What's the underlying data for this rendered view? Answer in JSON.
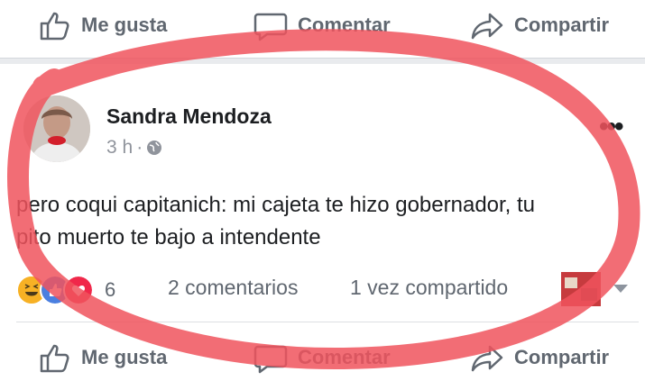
{
  "top_actions": {
    "like": "Me gusta",
    "comment": "Comentar",
    "share": "Compartir"
  },
  "post": {
    "author": "Sandra Mendoza",
    "time": "3 h",
    "separator": "·",
    "privacy_icon": "globe-icon",
    "text_line1": "pero coqui capitanich: mi cajeta te hizo gobernador, tu",
    "text_line2": "pito muerto te bajo a intendente",
    "reactions": [
      "haha-icon",
      "like-icon",
      "love-icon"
    ],
    "reaction_count": "6",
    "comments": "2 comentarios",
    "shares": "1 vez compartido"
  },
  "bottom_actions": {
    "like": "Me gusta",
    "comment": "Comentar",
    "share": "Compartir"
  },
  "colors": {
    "annotation": "#f0545d",
    "action_text": "#606770",
    "haha": "#f7b125",
    "like": "#4a7fe0",
    "love": "#f0284a"
  }
}
